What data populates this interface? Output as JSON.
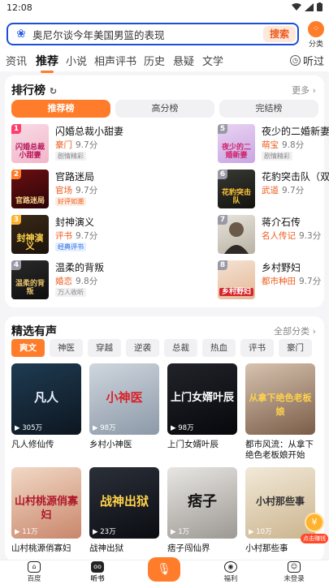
{
  "status": {
    "time": "12:08"
  },
  "search": {
    "query": "奥尼尔谈今年美国男篮的表现",
    "button": "搜索",
    "classify": "分类"
  },
  "tabs": [
    "资讯",
    "推荐",
    "小说",
    "相声评书",
    "历史",
    "悬疑",
    "文学"
  ],
  "listen": "听过",
  "ranking": {
    "title": "排行榜",
    "more": "更多",
    "segments": [
      "推荐榜",
      "高分榜",
      "完结榜"
    ],
    "items": [
      {
        "num": "1",
        "title": "闪婚总裁小甜妻",
        "genre": "豪门",
        "score": "9.7分",
        "tag": "剧情精彩",
        "cover": "闪婚总裁小甜妻"
      },
      {
        "num": "2",
        "title": "官路迷局",
        "genre": "官场",
        "score": "9.7分",
        "tag": "好评如潮",
        "cover": "官路迷局"
      },
      {
        "num": "3",
        "title": "封神演义",
        "genre": "评书",
        "score": "9.7分",
        "tag": "经典评书",
        "cover": "封神演义"
      },
      {
        "num": "4",
        "title": "温柔的背叛",
        "genre": "婚恋",
        "score": "9.8分",
        "tag": "万人收听",
        "cover": "温柔的背叛"
      },
      {
        "num": "5",
        "title": "夜少的二婚新妻",
        "genre": "萌宝",
        "score": "9.8分",
        "tag": "剧情精彩",
        "cover": "夜少的二婚新妻"
      },
      {
        "num": "6",
        "title": "花豹突击队（双",
        "genre": "武道",
        "score": "9.7分",
        "tag": "",
        "cover": "花豹突击队"
      },
      {
        "num": "7",
        "title": "蒋介石传",
        "genre": "名人传记",
        "score": "9.3分",
        "tag": "",
        "cover": ""
      },
      {
        "num": "8",
        "title": "乡村野妇",
        "genre": "都市种田",
        "score": "9.7分",
        "tag": "",
        "cover": "乡村野妇"
      }
    ]
  },
  "audio": {
    "title": "精选有声",
    "more": "全部分类",
    "chips": [
      "爽文",
      "神医",
      "穿越",
      "逆袭",
      "总裁",
      "热血",
      "评书",
      "豪门"
    ],
    "items": [
      {
        "title": "凡人修仙传",
        "plays": "305万",
        "art": "凡人"
      },
      {
        "title": "乡村小神医",
        "plays": "98万",
        "art": "小神医"
      },
      {
        "title": "上门女婿叶辰",
        "plays": "98万",
        "art": "上门女婿叶辰"
      },
      {
        "title": "都市风流：从拿下绝色老板娘开始",
        "plays": "",
        "art": "从拿下绝色老板娘"
      },
      {
        "title": "山村桃源俏寡妇",
        "plays": "11万",
        "art": "山村桃源俏寡妇"
      },
      {
        "title": "战神出狱",
        "plays": "23万",
        "art": "战神出狱"
      },
      {
        "title": "痞子闯仙界",
        "plays": "1万",
        "art": "痞子"
      },
      {
        "title": "小村那些事",
        "plays": "10万",
        "art": "小村那些事"
      }
    ]
  },
  "float": {
    "label": "点击赚钱"
  },
  "nav": [
    "百度",
    "听书",
    "",
    "福利",
    "未登录"
  ],
  "colors": {
    "accent": "#ff7c2a",
    "brand_blue": "#1b4fd6",
    "genre_orange": "#ee5a1c"
  }
}
